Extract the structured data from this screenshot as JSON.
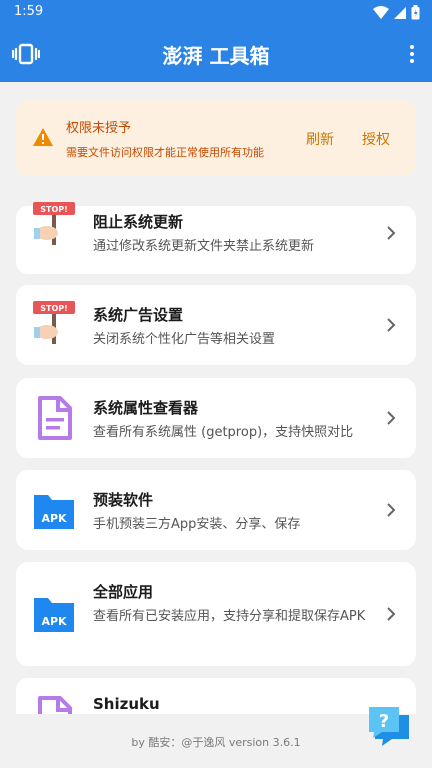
{
  "status": {
    "time": "1:59"
  },
  "app": {
    "title": "澎湃 工具箱"
  },
  "warning": {
    "title": "权限未授予",
    "description": "需要文件访问权限才能正常使用所有功能",
    "refresh_label": "刷新",
    "grant_label": "授权"
  },
  "tools": [
    {
      "title": "阻止系统更新",
      "description": "通过修改系统更新文件夹禁止系统更新",
      "icon": "stop-sign-icon"
    },
    {
      "title": "系统广告设置",
      "description": "关闭系统个性化广告等相关设置",
      "icon": "stop-sign-icon"
    },
    {
      "title": "系统属性查看器",
      "description": "查看所有系统属性 (getprop)，支持快照对比",
      "icon": "document-icon"
    },
    {
      "title": "预装软件",
      "description": "手机预装三方App安装、分享、保存",
      "icon": "apk-folder-icon"
    },
    {
      "title": "全部应用",
      "description": "查看所有已安装应用，支持分享和提取保存APK",
      "icon": "apk-folder-icon"
    },
    {
      "title": "Shizuku",
      "description": "",
      "icon": "document-icon"
    }
  ],
  "icon_text": {
    "stop": "STOP!",
    "apk": "APK",
    "help": "?"
  },
  "footer": {
    "text": "by 酷安：@于逸风 version 3.6.1"
  },
  "colors": {
    "primary": "#2b84e5",
    "warning_bg": "#fdf0e0",
    "warning_text": "#c84a00",
    "apk_blue": "#1e88f0",
    "doc_purple": "#b57be6"
  }
}
